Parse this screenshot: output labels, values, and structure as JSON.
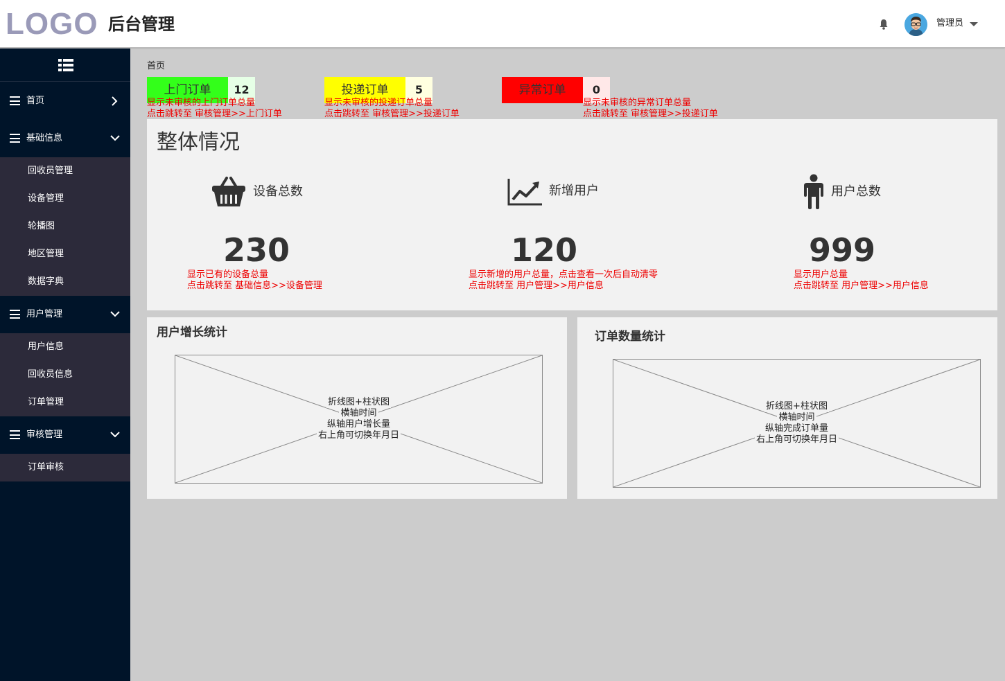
{
  "header": {
    "logo": "LOGO",
    "title": "后台管理",
    "user_name": "管理员"
  },
  "sidebar": {
    "groups": [
      {
        "label": "首页",
        "items": []
      },
      {
        "label": "基础信息",
        "items": [
          "回收员管理",
          "设备管理",
          "轮播图",
          "地区管理",
          "数据字典"
        ]
      },
      {
        "label": "用户管理",
        "items": [
          "用户信息",
          "回收员信息",
          "订单管理"
        ]
      },
      {
        "label": "审核管理",
        "items": [
          "订单审核"
        ]
      }
    ]
  },
  "breadcrumb": "首页",
  "order_tags": [
    {
      "label": "上门订单",
      "count": "12",
      "label_color": "#33ff1a",
      "count_color": "#e6ffe6",
      "note1": "显示未审核的上门订单总量",
      "note2": "点击跳转至 审核管理>>上门订单"
    },
    {
      "label": "投递订单",
      "count": "5",
      "label_color": "#ffff00",
      "count_color": "#ffffe0",
      "note1": "显示未审核的投递订单总量",
      "note2": "点击跳转至 审核管理>>投递订单"
    },
    {
      "label": "异常订单",
      "count": "0",
      "label_color": "#ff0000",
      "count_color": "#ffe8e8",
      "note1": "显示未审核的异常订单总量",
      "note2": "点击跳转至 审核管理>>投递订单"
    }
  ],
  "overview": {
    "title": "整体情况",
    "kpis": [
      {
        "label": "设备总数",
        "icon": "basket-icon",
        "value": "230",
        "note1": "显示已有的设备总量",
        "note2": "点击跳转至 基础信息>>设备管理"
      },
      {
        "label": "新增用户",
        "icon": "line-chart-icon",
        "value": "120",
        "note1": "显示新增的用户总量，点击查看一次后自动清零",
        "note2": "点击跳转至 用户管理>>用户信息"
      },
      {
        "label": "用户总数",
        "icon": "person-icon",
        "value": "999",
        "note1": "显示用户总量",
        "note2": "点击跳转至 用户管理>>用户信息"
      }
    ]
  },
  "charts": [
    {
      "title": "用户增长统计",
      "lines": [
        "折线图+柱状图",
        "横轴时间",
        "纵轴用户增长量",
        "右上角可切换年月日"
      ]
    },
    {
      "title": "订单数量统计",
      "lines": [
        "折线图+柱状图",
        "横轴时间",
        "纵轴完成订单量",
        "右上角可切换年月日"
      ]
    }
  ],
  "colors": {
    "header_bg": "#ffffff",
    "sidebar_bg": "#001429",
    "submenu_bg": "#2c2a3a",
    "content_bg": "#cccccc",
    "panel_bg": "#f2f2f2",
    "note_color": "#ee0000"
  }
}
